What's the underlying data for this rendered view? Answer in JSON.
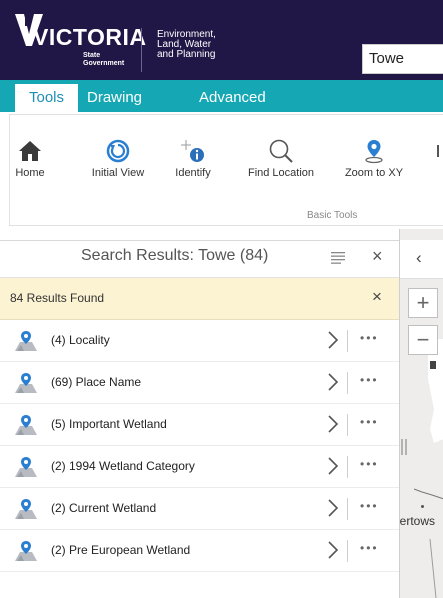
{
  "header": {
    "logo_text": "VICTORIA",
    "logo_sub1": "State",
    "logo_sub2": "Government",
    "department_lines": [
      "Environment,",
      "Land, Water",
      "and Planning"
    ],
    "search_value": "Towe"
  },
  "tabs": [
    {
      "label": "Tools",
      "active": true
    },
    {
      "label": "Drawing",
      "active": false
    },
    {
      "label": "Advanced",
      "active": false
    }
  ],
  "ribbon": {
    "tools": [
      {
        "label": "Home",
        "icon": "home-icon"
      },
      {
        "label": "Initial View",
        "icon": "refresh-icon"
      },
      {
        "label": "Identify",
        "icon": "identify-icon"
      },
      {
        "label": "Find Location",
        "icon": "search-icon"
      },
      {
        "label": "Zoom to XY",
        "icon": "map-pin-icon"
      }
    ],
    "group_label": "Basic Tools"
  },
  "panel": {
    "title": "Search Results: Towe (84)",
    "found_text": "84 Results Found",
    "results": [
      {
        "label": "(4) Locality"
      },
      {
        "label": "(69) Place Name"
      },
      {
        "label": "(5) Important Wetland"
      },
      {
        "label": "(2) 1994 Wetland Category"
      },
      {
        "label": "(2) Current Wetland"
      },
      {
        "label": "(2) Pre European Wetland"
      }
    ]
  },
  "map": {
    "zoom_in": "+",
    "zoom_out": "−",
    "town_label": "lertows"
  },
  "colors": {
    "header_bg": "#211747",
    "tab_bar": "#15a8b4",
    "active_tab_text": "#1d8fb5",
    "found_bar_bg": "#fcf3d2",
    "pin_blue": "#2a7fd0"
  }
}
